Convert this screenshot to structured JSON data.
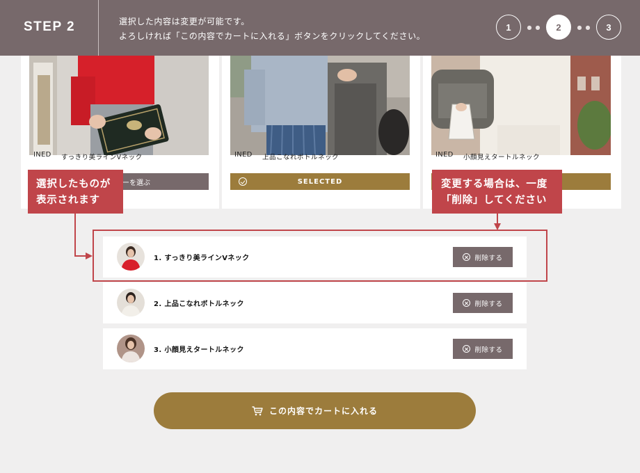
{
  "header": {
    "step_title": "STEP 2",
    "message_line1": "選択した内容は変更が可能です。",
    "message_line2": "よろしければ「この内容でカートに入れる」ボタンをクリックしてください。",
    "steps": [
      "1",
      "2",
      "3"
    ],
    "active_step": "2"
  },
  "products": [
    {
      "brand": "INED",
      "name": "すっきり美ラインVネック",
      "button_label": "ーを選ぶ",
      "state": "partial"
    },
    {
      "brand": "INED",
      "name": "上品こなれボトルネック",
      "button_label": "SELECTED",
      "state": "selected"
    },
    {
      "brand": "INED",
      "name": "小顔見えタートルネック",
      "button_label": "",
      "state": "selected"
    }
  ],
  "selected_items": [
    {
      "label": "1. すっきり美ラインVネック",
      "delete_label": "削除する"
    },
    {
      "label": "2. 上品こなれボトルネック",
      "delete_label": "削除する"
    },
    {
      "label": "3. 小顔見えタートルネック",
      "delete_label": "削除する"
    }
  ],
  "annotations": {
    "left_line1": "選択したものが",
    "left_line2": "表示されます",
    "right_line1": "変更する場合は、一度",
    "right_line2": "「削除」してください"
  },
  "cart_button_label": "この内容でカートに入れる",
  "colors": {
    "header_bg": "#77696b",
    "gold": "#9c7c3c",
    "annotation_red": "#c0454a",
    "page_bg": "#f0efef"
  }
}
